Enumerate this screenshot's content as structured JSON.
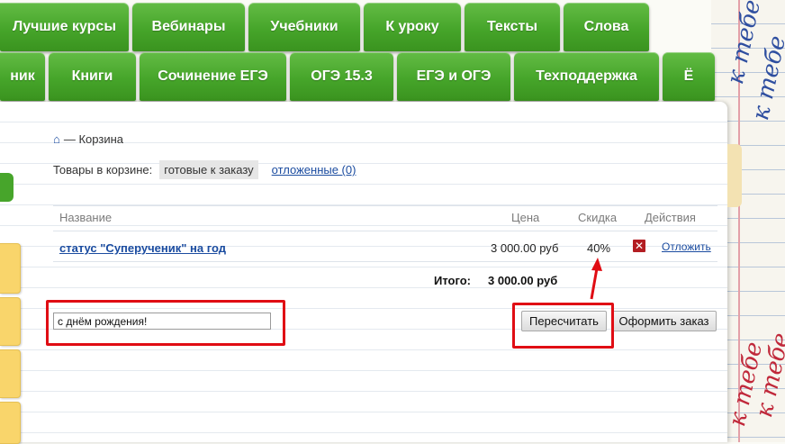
{
  "nav": {
    "row1": [
      "Лучшие курсы",
      "Вебинары",
      "Учебники",
      "К уроку",
      "Тексты",
      "Слова"
    ],
    "row2": [
      "ник",
      "Книги",
      "Сочинение ЕГЭ",
      "ОГЭ 15.3",
      "ЕГЭ и ОГЭ",
      "Техподдержка",
      "Ё"
    ]
  },
  "breadcrumb": {
    "home_icon": "⌂",
    "text": "— Корзина"
  },
  "cart": {
    "label": "Товары в корзине:",
    "ready_tab": "готовые к заказу",
    "deferred_link": "отложенные (0)"
  },
  "table": {
    "headers": {
      "name": "Название",
      "price": "Цена",
      "discount": "Скидка",
      "actions": "Действия"
    },
    "row": {
      "name": "статус \"Суперученик\" на год",
      "price": "3 000.00 руб",
      "discount": "40%",
      "delete_icon": "✕",
      "defer": "Отложить"
    },
    "total_label": "Итого:",
    "total_value": "3 000.00 руб"
  },
  "coupon": {
    "value": "с днём рождения!"
  },
  "buttons": {
    "recalculate": "Пересчитать",
    "checkout": "Оформить заказ"
  },
  "colors": {
    "nav_green": "#46a52a",
    "highlight_red": "#e00d14",
    "link_blue": "#1b4ca0"
  }
}
